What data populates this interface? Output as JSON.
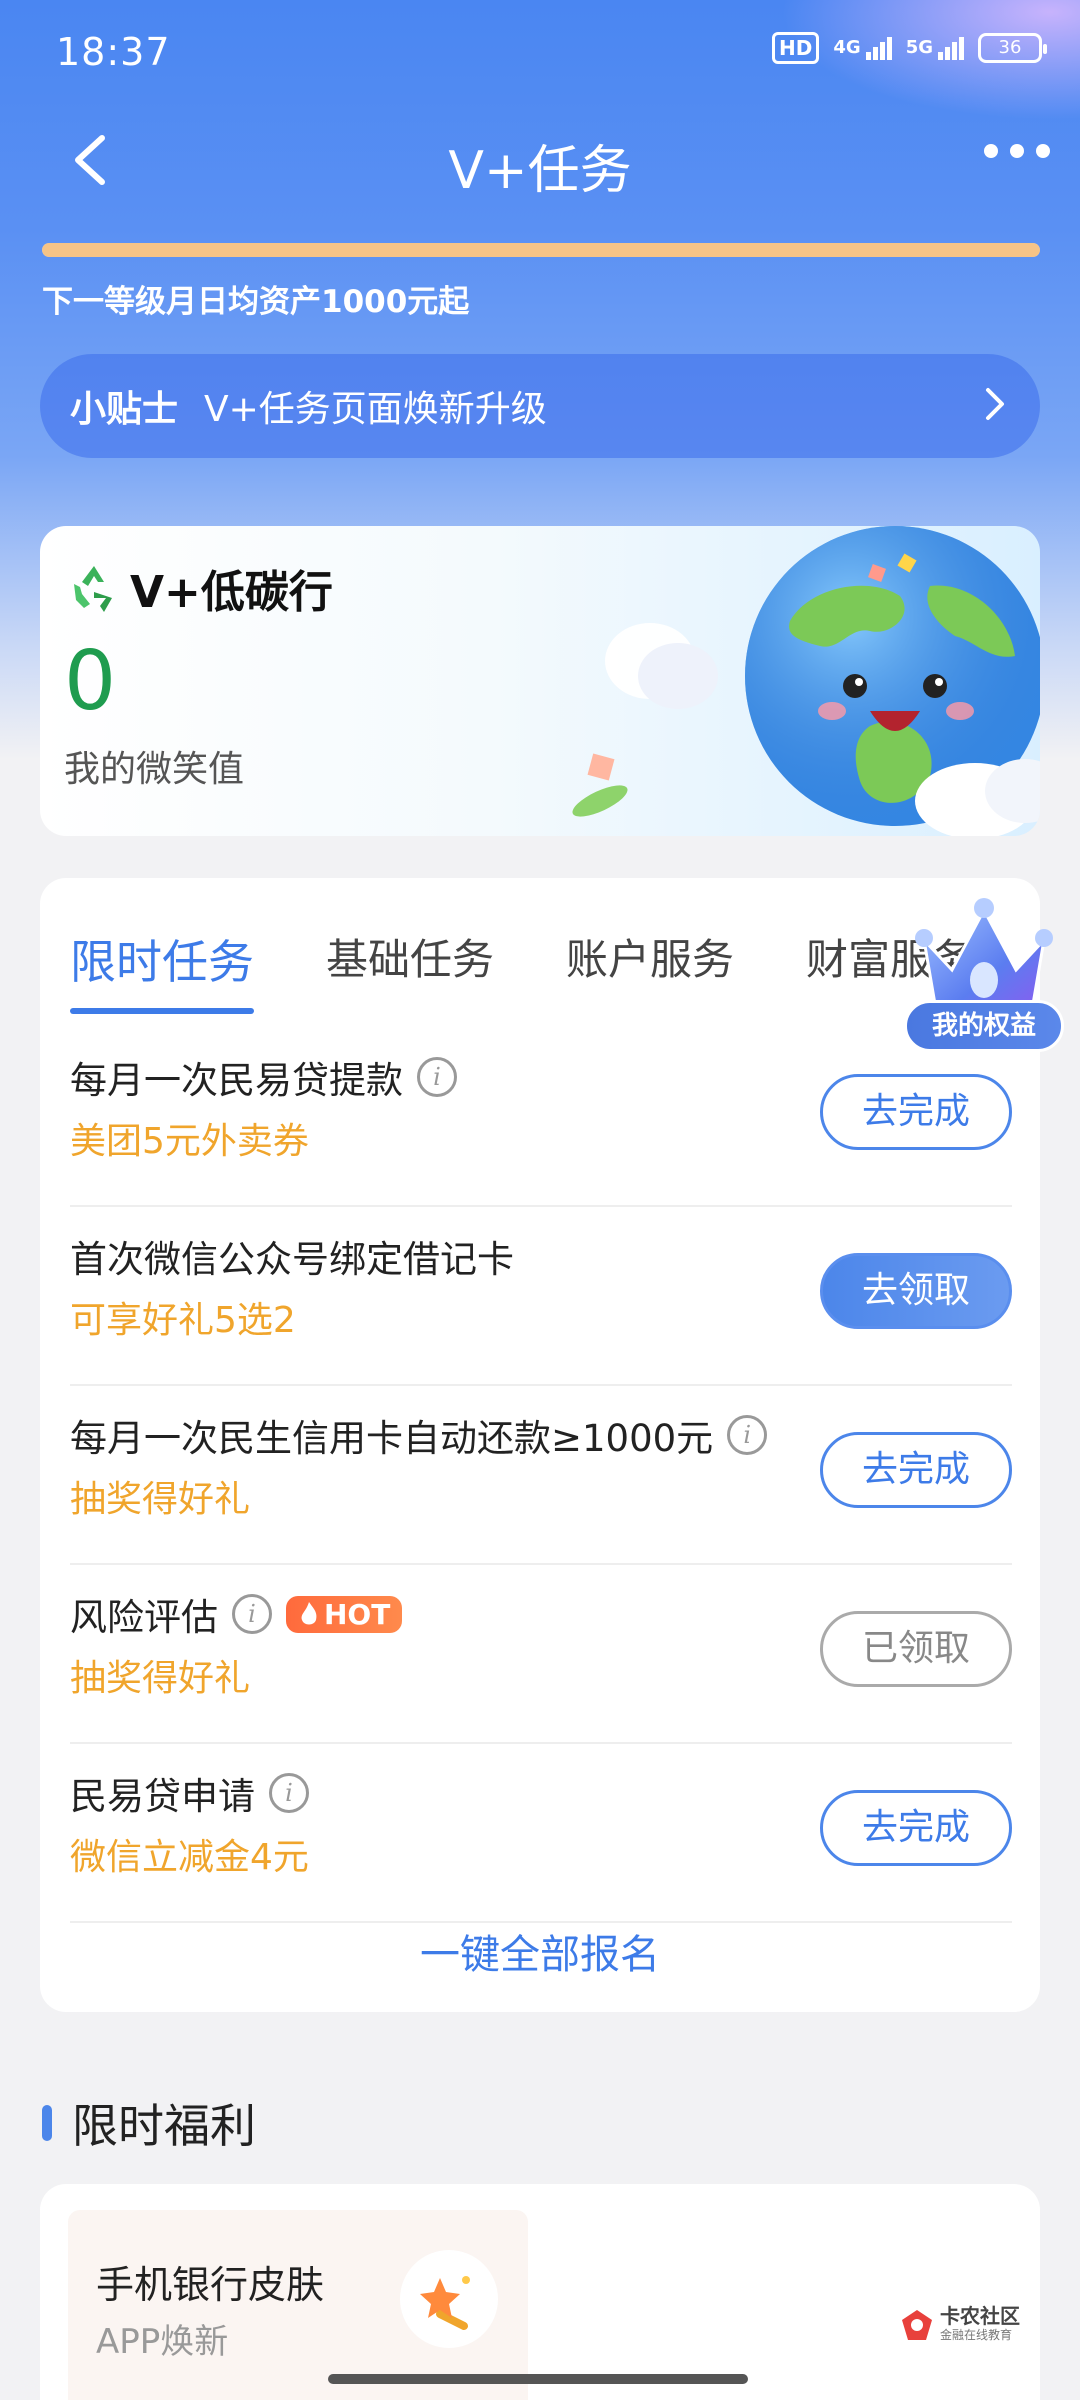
{
  "status_bar": {
    "time": "18:37",
    "hd_badge": "HD",
    "net1": "4G",
    "net2": "5G",
    "battery": "36"
  },
  "nav": {
    "title": "V+任务"
  },
  "level": {
    "progress": 1.0,
    "hint": "下一等级月日均资产1000元起"
  },
  "tip": {
    "label": "小贴士",
    "text": "V+任务页面焕新升级"
  },
  "carbon": {
    "title": "V+低碳行",
    "value": "0",
    "label": "我的微笑值"
  },
  "tabs": [
    {
      "label": "限时任务",
      "active": true
    },
    {
      "label": "基础任务",
      "active": false
    },
    {
      "label": "账户服务",
      "active": false
    },
    {
      "label": "财富服务",
      "active": false
    }
  ],
  "tasks": [
    {
      "name": "每月一次民易贷提款",
      "info": true,
      "hot": false,
      "reward": "美团5元外卖券",
      "button": "去完成",
      "state": "outline"
    },
    {
      "name": "首次微信公众号绑定借记卡",
      "info": false,
      "hot": false,
      "reward": "可享好礼5选2",
      "button": "去领取",
      "state": "filled"
    },
    {
      "name": "每月一次民生信用卡自动还款≥1000元",
      "info": true,
      "hot": false,
      "reward": "抽奖得好礼",
      "button": "去完成",
      "state": "outline"
    },
    {
      "name": "风险评估",
      "info": true,
      "hot": true,
      "reward": "抽奖得好礼",
      "button": "已领取",
      "state": "done"
    },
    {
      "name": "民易贷申请",
      "info": true,
      "hot": false,
      "reward": "微信立减金4元",
      "button": "去完成",
      "state": "outline"
    }
  ],
  "hot_label": "HOT",
  "info_glyph": "i",
  "signup_all": "一键全部报名",
  "crown_badge": "我的权益",
  "welfare": {
    "section_title": "限时福利",
    "item_title": "手机银行皮肤",
    "item_sub": "APP焕新"
  },
  "watermark": {
    "line1": "卡农社区",
    "line2": "金融在线教育"
  },
  "colors": {
    "accent": "#3d7be8",
    "reward": "#f0a52c",
    "carbon_value": "#1f9c4f",
    "progress": "#f6c487",
    "hot": "#ff6a3c"
  }
}
